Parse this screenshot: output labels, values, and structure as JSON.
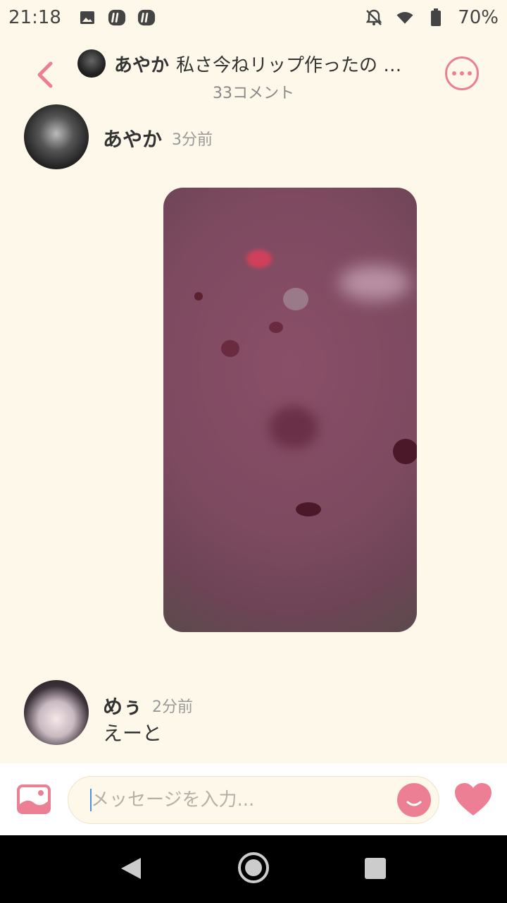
{
  "status_bar": {
    "time": "21:18",
    "battery": "70%",
    "icons": [
      "image-icon",
      "app-notification-icon",
      "app-notification-icon",
      "bell-off-icon",
      "wifi-icon",
      "battery-icon"
    ]
  },
  "header": {
    "name": "あやか",
    "title": "私さ今ねリップ作ったの …",
    "subtitle": "33コメント"
  },
  "messages": [
    {
      "name": "あやか",
      "time": "3分前",
      "has_image": true
    },
    {
      "name": "めぅ",
      "time": "2分前",
      "text": "えーと"
    }
  ],
  "input": {
    "placeholder": "メッセージを入力..."
  },
  "colors": {
    "accent": "#ec7f93",
    "background": "#fdf8ea"
  }
}
